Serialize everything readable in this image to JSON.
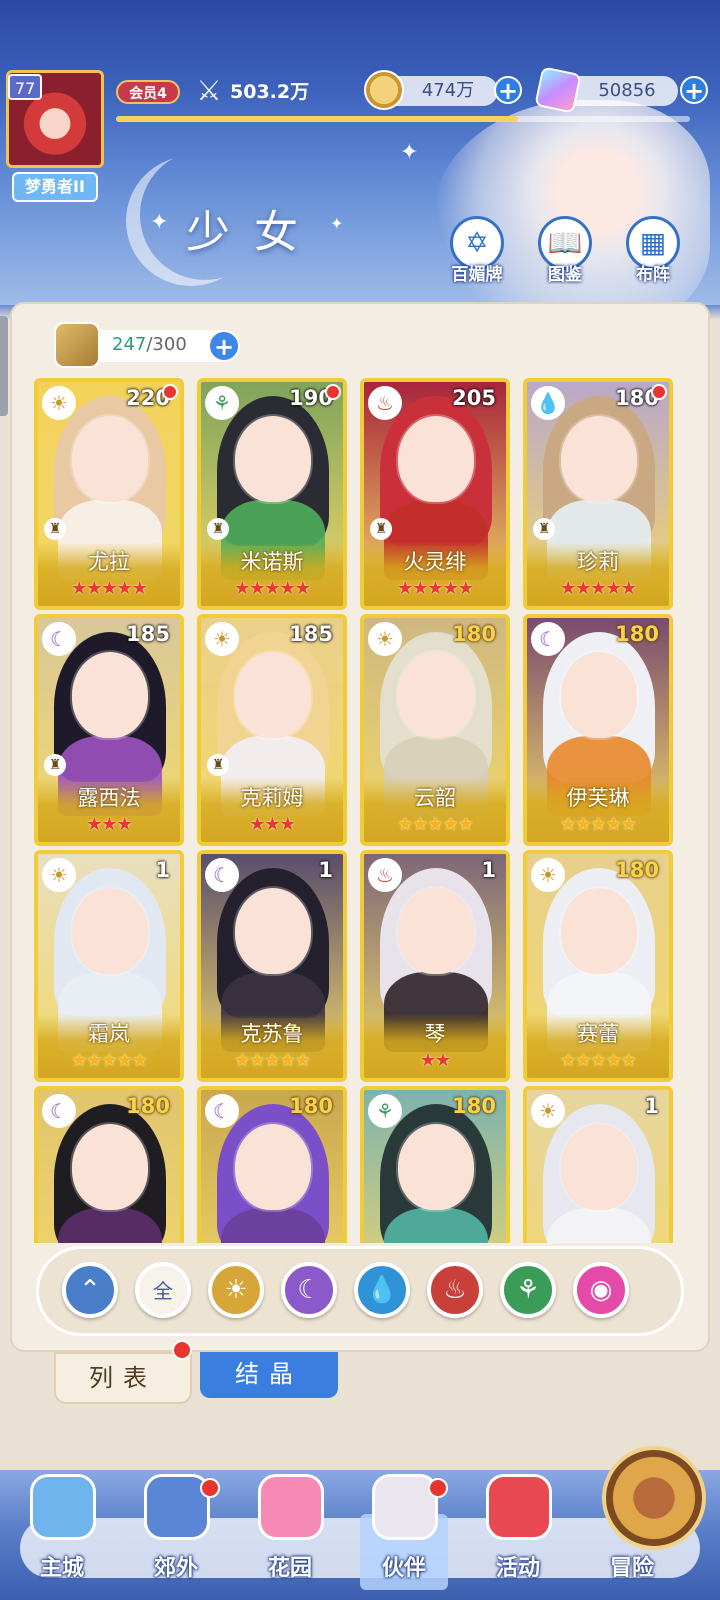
{
  "player": {
    "level": "77",
    "title": "梦勇者II",
    "vip": "会员4",
    "power": "503.2万",
    "exp_fraction": 0.7
  },
  "resources": {
    "gold": "474万",
    "gems": "50856"
  },
  "page": {
    "title": "少女"
  },
  "header_buttons": [
    {
      "label": "百媚牌",
      "icon": "card-hexagram-icon"
    },
    {
      "label": "图鉴",
      "icon": "book-icon"
    },
    {
      "label": "布阵",
      "icon": "grid-formation-icon"
    }
  ],
  "capacity": {
    "current": "247",
    "max": "/300"
  },
  "colors": {
    "accent_blue": "#2e7de0",
    "card_gold": "#f0cc38",
    "notification_red": "#e8352e",
    "star_red": "#e7392f",
    "star_gold": "#f9b31b"
  },
  "cards": [
    {
      "name": "尤拉",
      "level": "220",
      "element": "sun-element-icon",
      "stars": 5,
      "star_color": "red",
      "dot": true,
      "role": true,
      "hair": "#e9c9a3",
      "body": "#f7f2ec",
      "bg": "#f3d25a"
    },
    {
      "name": "米诺斯",
      "level": "190",
      "element": "wind-element-icon",
      "stars": 5,
      "star_color": "red",
      "dot": true,
      "role": true,
      "hair": "#2b2b33",
      "body": "#4fae59",
      "bg": "#7fa45b"
    },
    {
      "name": "火灵绯",
      "level": "205",
      "element": "fire-element-icon",
      "stars": 5,
      "star_color": "red",
      "dot": false,
      "role": true,
      "hair": "#c9303a",
      "body": "#c22f2a",
      "bg": "#a8243b"
    },
    {
      "name": "珍莉",
      "level": "180",
      "element": "water-element-icon",
      "stars": 5,
      "star_color": "red",
      "dot": true,
      "role": true,
      "hair": "#c9a883",
      "body": "#e6eef5",
      "bg": "#b9a8c9"
    },
    {
      "name": "露西法",
      "level": "185",
      "element": "moon-element-icon",
      "stars": 3,
      "star_color": "red",
      "dot": false,
      "role": true,
      "hair": "#1e1a2a",
      "body": "#9c52c0",
      "bg": "#d9c89a"
    },
    {
      "name": "克莉姆",
      "level": "185",
      "element": "sun-element-icon",
      "stars": 3,
      "star_color": "red",
      "dot": false,
      "role": true,
      "hair": "#f1d491",
      "body": "#f2f0f6",
      "bg": "#ead08a"
    },
    {
      "name": "云韶",
      "level": "180",
      "element": "sun-element-icon",
      "stars": 5,
      "star_color": "gold",
      "dot": false,
      "role": false,
      "hair": "#e3dfcc",
      "body": "#d8cfb8",
      "bg": "#cfb880"
    },
    {
      "name": "伊芙琳",
      "level": "180",
      "element": "moon-element-icon",
      "stars": 5,
      "star_color": "gold",
      "dot": false,
      "role": false,
      "hair": "#eef0f5",
      "body": "#e8882b",
      "bg": "#7a4b6e"
    },
    {
      "name": "霜岚",
      "level": "1",
      "element": "sun-element-icon",
      "stars": 5,
      "star_color": "gold",
      "dot": false,
      "role": false,
      "hair": "#e2e8f2",
      "body": "#eaeef5",
      "bg": "#e9dfbf"
    },
    {
      "name": "克苏鲁",
      "level": "1",
      "element": "moon-element-icon",
      "stars": 5,
      "star_color": "gold",
      "dot": false,
      "role": false,
      "hair": "#25202e",
      "body": "#3b3241",
      "bg": "#5a4d6d"
    },
    {
      "name": "琴",
      "level": "1",
      "element": "fire-element-icon",
      "stars": 2,
      "star_color": "red",
      "dot": false,
      "role": false,
      "hair": "#e8e2ea",
      "body": "#2e2428",
      "bg": "#7d6777"
    },
    {
      "name": "赛蕾",
      "level": "180",
      "element": "sun-element-icon",
      "stars": 5,
      "star_color": "gold",
      "dot": false,
      "role": false,
      "hair": "#eceef4",
      "body": "#f5f5f8",
      "bg": "#e7d08d"
    },
    {
      "name": "",
      "level": "180",
      "element": "moon-element-icon",
      "stars": 0,
      "star_color": "gold",
      "dot": false,
      "role": false,
      "hair": "#1f1c22",
      "body": "#5c2f6d",
      "bg": "#e1c470"
    },
    {
      "name": "",
      "level": "180",
      "element": "moon-element-icon",
      "stars": 0,
      "star_color": "gold",
      "dot": false,
      "role": false,
      "hair": "#7a4fc7",
      "body": "#6a3e9a",
      "bg": "#c9a84e"
    },
    {
      "name": "",
      "level": "180",
      "element": "wind-element-icon",
      "stars": 0,
      "star_color": "gold",
      "dot": false,
      "role": false,
      "hair": "#2a3a3a",
      "body": "#52b6a3",
      "bg": "#7db3ae"
    },
    {
      "name": "",
      "level": "1",
      "element": "sun-element-icon",
      "stars": 0,
      "star_color": "gold",
      "dot": false,
      "role": false,
      "hair": "#e6e7ef",
      "body": "#f4f4f6",
      "bg": "#e6d59f"
    }
  ],
  "filters": [
    {
      "icon": "wind-arrow-icon",
      "label": "",
      "color": "#4a7ec9"
    },
    {
      "icon": "all-icon",
      "label": "全",
      "color": "#f7f3ea"
    },
    {
      "icon": "sun-element-icon",
      "label": "",
      "color": "#d6a638"
    },
    {
      "icon": "moon-element-icon",
      "label": "",
      "color": "#8b59c9"
    },
    {
      "icon": "water-element-icon",
      "label": "",
      "color": "#2f93d6"
    },
    {
      "icon": "fire-element-icon",
      "label": "",
      "color": "#c9403a"
    },
    {
      "icon": "wind-element-icon",
      "label": "",
      "color": "#3b9c57"
    },
    {
      "icon": "heart-element-icon",
      "label": "",
      "color": "#e44aa8"
    }
  ],
  "tabs": {
    "list": "列表",
    "crystal": "结晶"
  },
  "nav": [
    {
      "label": "主城",
      "icon": "castle-icon",
      "dot": false,
      "active": false
    },
    {
      "label": "郊外",
      "icon": "magic-circle-icon",
      "dot": true,
      "active": false
    },
    {
      "label": "花园",
      "icon": "heart-garden-icon",
      "dot": false,
      "active": false
    },
    {
      "label": "伙伴",
      "icon": "partner-portrait-icon",
      "dot": true,
      "active": true
    },
    {
      "label": "活动",
      "icon": "gift-box-icon",
      "dot": false,
      "active": false
    },
    {
      "label": "冒险",
      "icon": "compass-icon",
      "dot": false,
      "active": false
    }
  ]
}
